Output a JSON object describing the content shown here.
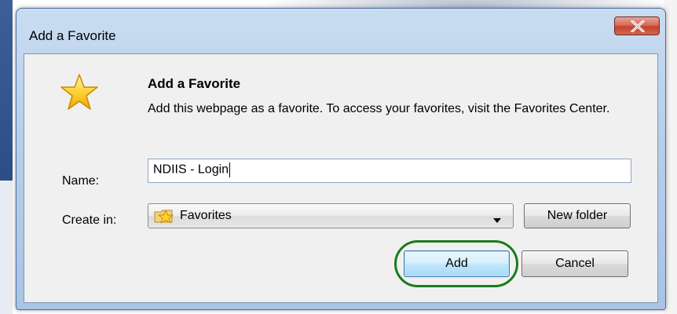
{
  "window": {
    "title": "Add a Favorite",
    "close_label": "X"
  },
  "dialog": {
    "heading": "Add a Favorite",
    "description": "Add this webpage as a favorite. To access your favorites, visit the Favorites Center.",
    "header_icon": "star-icon"
  },
  "form": {
    "name_label": "Name:",
    "name_value": "NDIIS - Login",
    "create_in_label": "Create in:",
    "create_in_value": "Favorites",
    "create_in_icon": "favorites-folder-icon",
    "new_folder_label": "New folder"
  },
  "buttons": {
    "add_label": "Add",
    "cancel_label": "Cancel"
  },
  "annotation": {
    "highlight_color": "#1c7a1c",
    "highlighted": "add-button"
  }
}
